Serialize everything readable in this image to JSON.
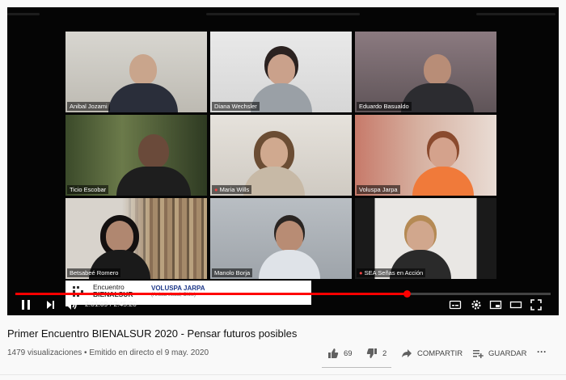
{
  "video": {
    "tiles": [
      {
        "name": "Anibal Jozami",
        "mic_icon": false,
        "active": false
      },
      {
        "name": "Diana Wechsler",
        "mic_icon": false,
        "active": false
      },
      {
        "name": "Eduardo Basualdo",
        "mic_icon": false,
        "active": false
      },
      {
        "name": "Ticio Escobar",
        "mic_icon": false,
        "active": false
      },
      {
        "name": "Maria Wills",
        "mic_icon": true,
        "active": false
      },
      {
        "name": "Voluspa Jarpa",
        "mic_icon": false,
        "active": true
      },
      {
        "name": "Betsabeé Romero",
        "mic_icon": false,
        "active": false
      },
      {
        "name": "Manolo Borja",
        "mic_icon": false,
        "active": false
      },
      {
        "name": "SEA Señas en Acción",
        "mic_icon": true,
        "active": false
      }
    ],
    "overlay": {
      "brand_line1": "Encuentro",
      "brand_line2": "BIENALSUR",
      "speaker": "VOLUSPA JARPA",
      "speaker_country": "(Artista visual, Chile)"
    },
    "time_current": "2:01:09",
    "time_total": "2:45:20",
    "time_display": "2:01:09 / 2:45:20",
    "progress_fraction": 0.731,
    "colors": {
      "progress": "#ff0000",
      "active_tile": "#e3e55a"
    }
  },
  "info": {
    "title": "Primer Encuentro BIENALSUR 2020 - Pensar futuros posibles",
    "meta": "1479 visualizaciones • Emitido en directo el 9 may. 2020",
    "likes": "69",
    "dislikes": "2",
    "share_label": "COMPARTIR",
    "save_label": "GUARDAR",
    "more_label": "···"
  }
}
